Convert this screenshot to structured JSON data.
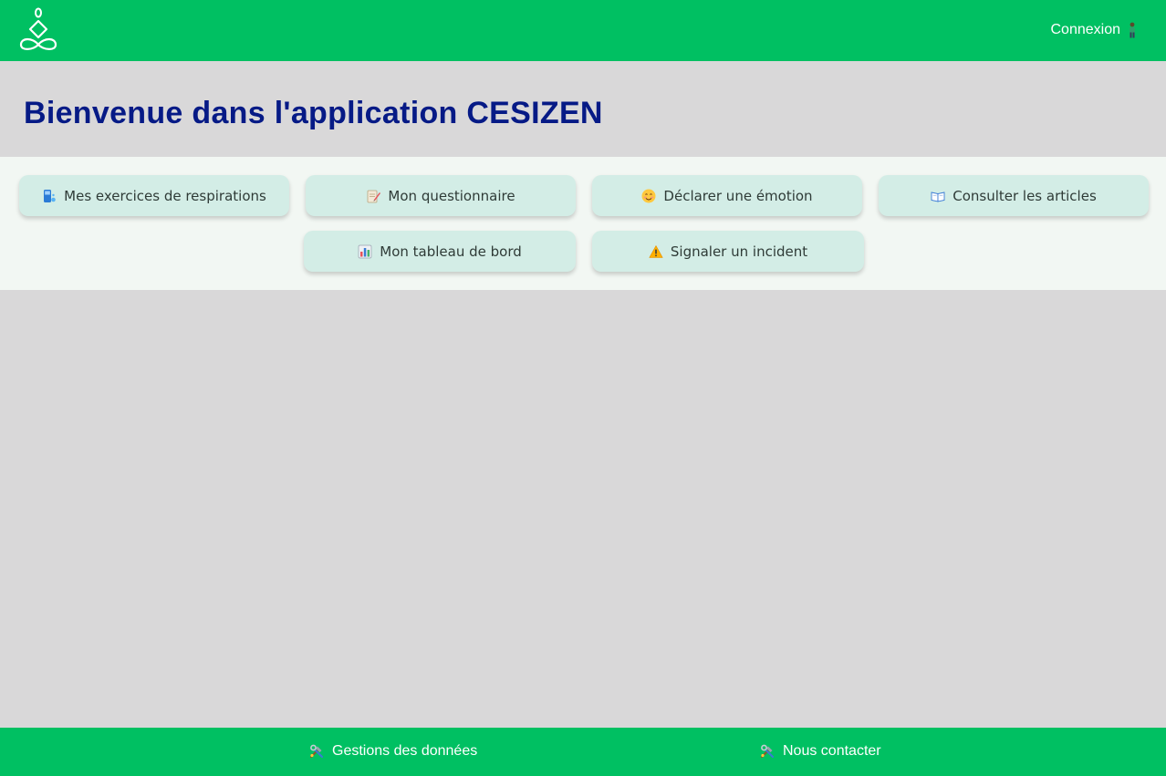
{
  "header": {
    "login_label": "Connexion",
    "logo_icon": "meditation-logo-icon",
    "login_icon": "person-icon",
    "background_color": "#00c062"
  },
  "banner": {
    "title": "Bienvenue dans l'application CESIZEN",
    "title_color": "#061a86"
  },
  "nav": {
    "items": [
      {
        "label": "Mes exercices de respirations",
        "icon": "person-breathing-icon"
      },
      {
        "label": "Mon questionnaire",
        "icon": "memo-icon"
      },
      {
        "label": "Déclarer une émotion",
        "icon": "smiling-face-icon"
      },
      {
        "label": "Consulter les articles",
        "icon": "open-book-icon"
      },
      {
        "label": "Mon tableau de bord",
        "icon": "bar-chart-icon"
      },
      {
        "label": "Signaler un incident",
        "icon": "warning-icon"
      }
    ],
    "button_color": "#d3ede6"
  },
  "footer": {
    "links": [
      {
        "label": "Gestions des données",
        "icon": "tools-icon"
      },
      {
        "label": "Nous contacter",
        "icon": "tools-icon"
      }
    ],
    "background_color": "#00c062"
  }
}
